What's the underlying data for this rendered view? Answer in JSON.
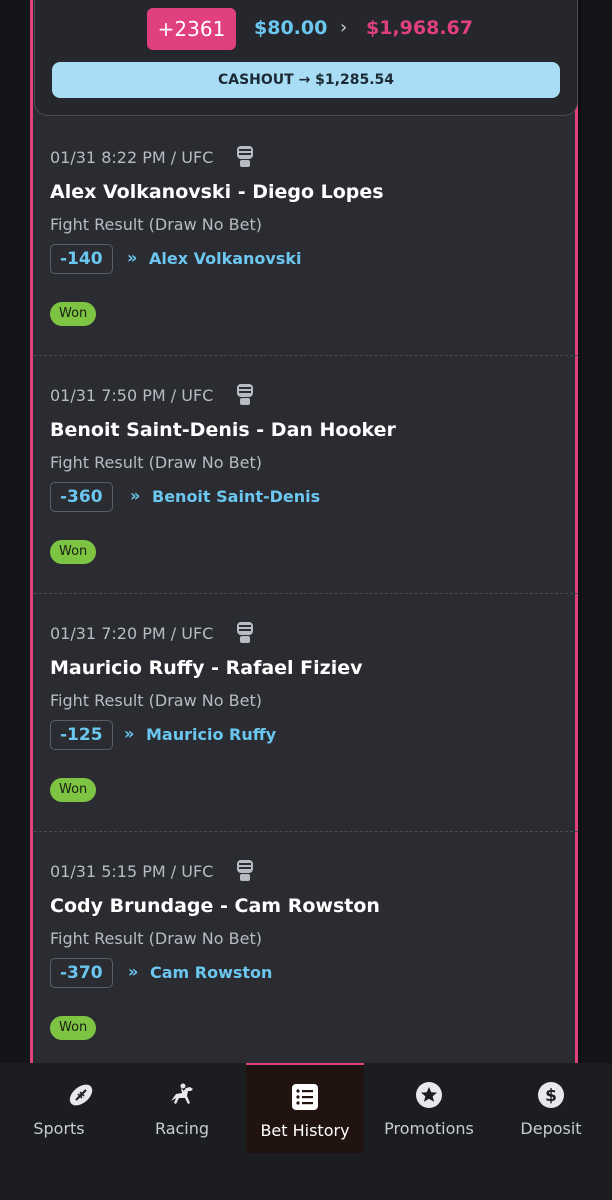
{
  "slip": {
    "odds": "+2361",
    "stake": "$80.00",
    "separator": "›",
    "payout": "$1,968.67",
    "cashout": "CASHOUT → $1,285.54"
  },
  "legs": [
    {
      "datetime": "01/31 8:22 PM  /  UFC",
      "matchup": "Alex Volkanovski - Diego Lopes",
      "market": "Fight Result (Draw No Bet)",
      "line": "-140",
      "chevron": "»",
      "selection": "Alex Volkanovski",
      "status": "Won"
    },
    {
      "datetime": "01/31 7:50 PM  /  UFC",
      "matchup": "Benoit Saint-Denis - Dan Hooker",
      "market": "Fight Result (Draw No Bet)",
      "line": "-360",
      "chevron": "»",
      "selection": "Benoit Saint-Denis",
      "status": "Won"
    },
    {
      "datetime": "01/31 7:20 PM  /  UFC",
      "matchup": "Mauricio Ruffy - Rafael Fiziev",
      "market": "Fight Result (Draw No Bet)",
      "line": "-125",
      "chevron": "»",
      "selection": "Mauricio Ruffy",
      "status": "Won"
    },
    {
      "datetime": "01/31 5:15 PM  /  UFC",
      "matchup": "Cody Brundage - Cam Rowston",
      "market": "Fight Result (Draw No Bet)",
      "line": "-370",
      "chevron": "»",
      "selection": "Cam Rowston",
      "status": "Won"
    }
  ],
  "nav": {
    "items": [
      {
        "label": "Sports",
        "icon": "football-icon"
      },
      {
        "label": "Racing",
        "icon": "horse-racing-icon"
      },
      {
        "label": "Bet History",
        "icon": "list-icon",
        "active": true
      },
      {
        "label": "Promotions",
        "icon": "star-icon"
      },
      {
        "label": "Deposit",
        "icon": "dollar-icon"
      }
    ]
  },
  "colors": {
    "accent": "#e0407f",
    "link": "#6cc7f0",
    "won": "#7ec443",
    "cashout_bg": "#a8ddf5",
    "card_bg": "#2a2c31"
  }
}
